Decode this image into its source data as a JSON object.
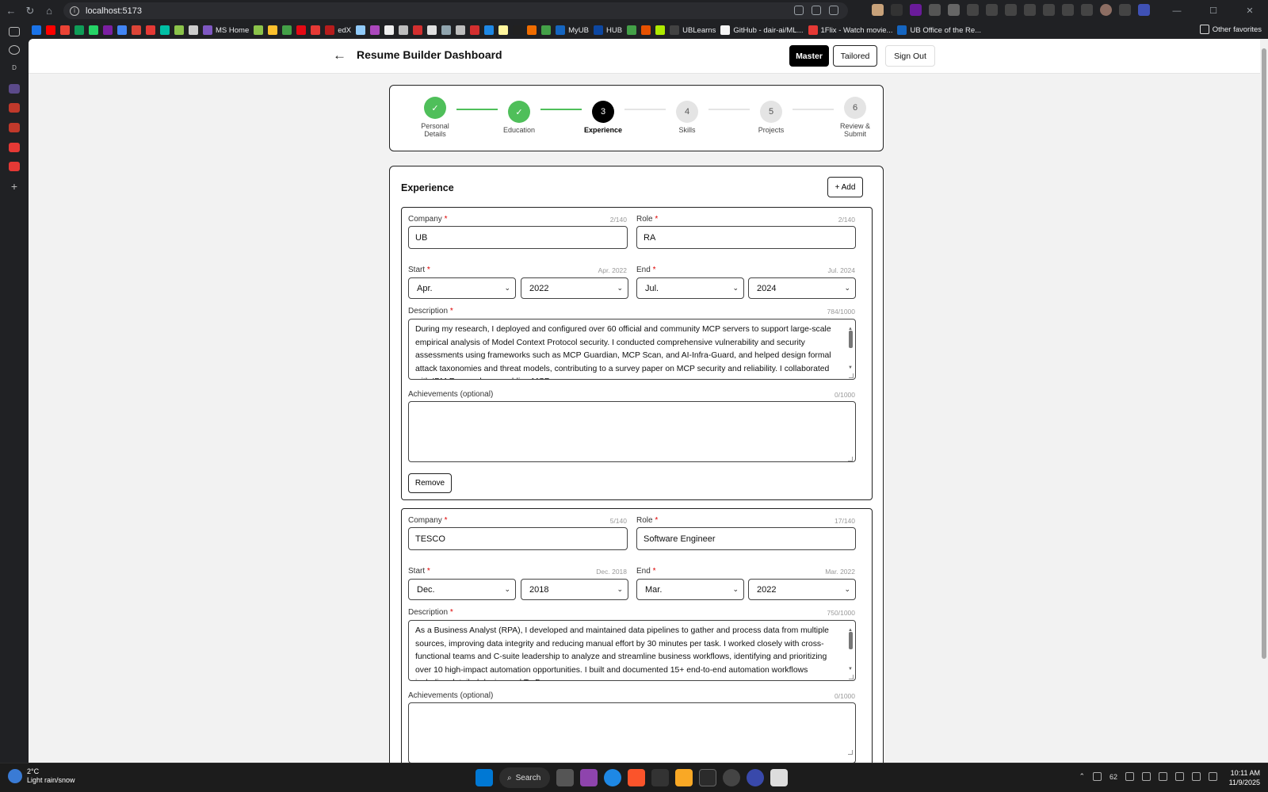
{
  "browser": {
    "url": "localhost:5173",
    "bookmarks": [
      {
        "label": "",
        "color": "#1a73e8"
      },
      {
        "label": "",
        "color": "#ff0000"
      },
      {
        "label": "",
        "color": "#ea4335"
      },
      {
        "label": "",
        "color": "#0f9d58"
      },
      {
        "label": "",
        "color": "#25d366"
      },
      {
        "label": "",
        "color": "#7b1fa2"
      },
      {
        "label": "",
        "color": "#4285f4"
      },
      {
        "label": "",
        "color": "#db4437"
      },
      {
        "label": "",
        "color": "#e53935"
      },
      {
        "label": "",
        "color": "#00bfa5"
      },
      {
        "label": "",
        "color": "#8bc34a"
      },
      {
        "label": "",
        "color": "#cccccc"
      },
      {
        "label": "MS Home",
        "color": "#7e57c2"
      },
      {
        "label": "",
        "color": "#8bc34a"
      },
      {
        "label": "",
        "color": "#fbc02d"
      },
      {
        "label": "",
        "color": "#43a047"
      },
      {
        "label": "",
        "color": "#e50914"
      },
      {
        "label": "",
        "color": "#e53935"
      },
      {
        "label": "edX",
        "color": "#b71c1c"
      },
      {
        "label": "",
        "color": "#90caf9"
      },
      {
        "label": "",
        "color": "#ab47bc"
      },
      {
        "label": "",
        "color": "#eeeeee"
      },
      {
        "label": "",
        "color": "#bdbdbd"
      },
      {
        "label": "",
        "color": "#d32f2f"
      },
      {
        "label": "",
        "color": "#e0e0e0"
      },
      {
        "label": "",
        "color": "#90a4ae"
      },
      {
        "label": "",
        "color": "#bdbdbd"
      },
      {
        "label": "",
        "color": "#d32f2f"
      },
      {
        "label": "",
        "color": "#1e88e5"
      },
      {
        "label": "",
        "color": "#fff59d"
      },
      {
        "label": "",
        "color": "#212121"
      },
      {
        "label": "",
        "color": "#ef6c00"
      },
      {
        "label": "",
        "color": "#43a047"
      },
      {
        "label": "MyUB",
        "color": "#1565c0"
      },
      {
        "label": "HUB",
        "color": "#0d47a1"
      },
      {
        "label": "",
        "color": "#43a047"
      },
      {
        "label": "",
        "color": "#e65100"
      },
      {
        "label": "",
        "color": "#aeea00"
      },
      {
        "label": "UBLearns",
        "color": "#424242"
      },
      {
        "label": "GitHub - dair-ai/ML...",
        "color": "#f5f5f5"
      },
      {
        "label": "1Flix - Watch movie...",
        "color": "#e53935"
      },
      {
        "label": "UB Office of the Re...",
        "color": "#1565c0"
      }
    ],
    "other_favorites": "Other favorites"
  },
  "app": {
    "title": "Resume Builder Dashboard",
    "master_label": "Master",
    "tailored_label": "Tailored",
    "signout_label": "Sign Out"
  },
  "stepper": {
    "steps": [
      {
        "num": "✓",
        "label": "Personal Details",
        "state": "done"
      },
      {
        "num": "✓",
        "label": "Education",
        "state": "done"
      },
      {
        "num": "3",
        "label": "Experience",
        "state": "current"
      },
      {
        "num": "4",
        "label": "Skills",
        "state": "todo"
      },
      {
        "num": "5",
        "label": "Projects",
        "state": "todo"
      },
      {
        "num": "6",
        "label": "Review & Submit",
        "state": "todo"
      }
    ]
  },
  "experience": {
    "title": "Experience",
    "add_label": "+ Add",
    "labels": {
      "company": "Company",
      "role": "Role",
      "start": "Start",
      "end": "End",
      "description": "Description",
      "achievements": "Achievements (optional)",
      "required_mark": "*",
      "remove": "Remove"
    },
    "entries": [
      {
        "company": "UB",
        "company_count": "2/140",
        "role": "RA",
        "role_count": "2/140",
        "start_month": "Apr.",
        "start_year": "2022",
        "start_hint": "Apr. 2022",
        "end_month": "Jul.",
        "end_year": "2024",
        "end_hint": "Jul. 2024",
        "description": "During my research, I deployed and configured over 60 official and community MCP servers to support large-scale empirical analysis of Model Context Protocol security. I conducted comprehensive vulnerability and security assessments using frameworks such as MCP Guardian, MCP Scan, and AI-Infra-Guard, and helped design formal attack taxonomies and threat models, contributing to a survey paper on MCP security and reliability. I collaborated with IBM Research on enabling MCP",
        "description_count": "784/1000",
        "achievements": "",
        "achievements_count": "0/1000"
      },
      {
        "company": "TESCO",
        "company_count": "5/140",
        "role": "Software Engineer",
        "role_count": "17/140",
        "start_month": "Dec.",
        "start_year": "2018",
        "start_hint": "Dec. 2018",
        "end_month": "Mar.",
        "end_year": "2022",
        "end_hint": "Mar. 2022",
        "description": "As a Business Analyst (RPA), I developed and maintained data pipelines to gather and process data from multiple sources, improving data integrity and reducing manual effort by 30 minutes per task. I worked closely with cross-functional teams and C-suite leadership to analyze and streamline business workflows, identifying and prioritizing over 10 high-impact automation opportunities. I built and documented 15+ end-to-end automation workflows including detailed design and To-Be",
        "description_count": "750/1000",
        "achievements": "",
        "achievements_count": "0/1000"
      }
    ]
  },
  "taskbar": {
    "temp": "2°C",
    "weather": "Light rain/snow",
    "search_label": "Search",
    "battery": "62",
    "time": "10:11 AM",
    "date": "11/9/2025"
  }
}
